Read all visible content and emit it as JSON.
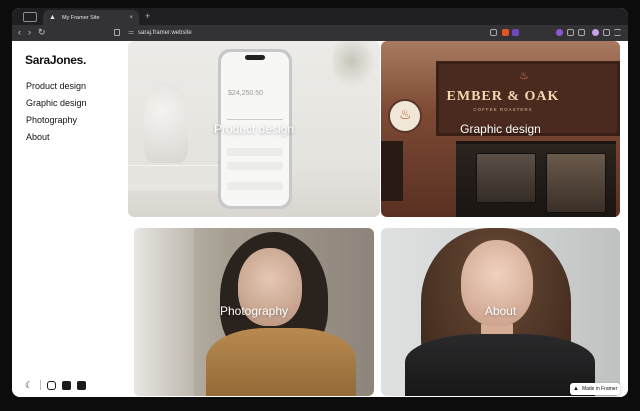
{
  "browser": {
    "tab_title": "My Framer Site",
    "tab_close": "×",
    "new_tab": "+",
    "url": "saraj.framer.website",
    "back": "‹",
    "forward": "›",
    "reload": "↻"
  },
  "site": {
    "logo": "SaraJones",
    "logo_dot": ".",
    "menu": [
      {
        "label": "Product design"
      },
      {
        "label": "Graphic design"
      },
      {
        "label": "Photography"
      },
      {
        "label": "About"
      }
    ],
    "social_icons": [
      "moon-icon",
      "instagram-icon",
      "linkedin-icon",
      "facebook-icon"
    ]
  },
  "cards": [
    {
      "label": "Product design"
    },
    {
      "label": "Graphic design"
    },
    {
      "label": "Photography"
    },
    {
      "label": "About"
    }
  ],
  "product_mock": {
    "amount": "$24,250.50"
  },
  "storefront": {
    "sign": "EMBER & OAK",
    "sign_sub": "COFFEE ROASTERS"
  },
  "badge": {
    "label": "Made in Framer"
  }
}
